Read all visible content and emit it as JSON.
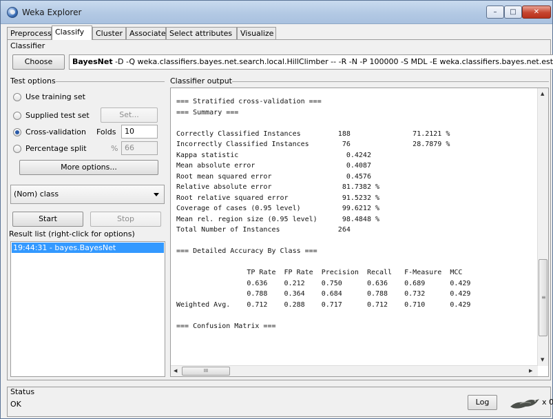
{
  "window": {
    "title": "Weka Explorer",
    "controls": {
      "minimize": "–",
      "maximize": "□",
      "close": "✕"
    }
  },
  "tabs": [
    "Preprocess",
    "Classify",
    "Cluster",
    "Associate",
    "Select attributes",
    "Visualize"
  ],
  "active_tab": "Classify",
  "classifier": {
    "group_title": "Classifier",
    "choose_label": "Choose",
    "name": "BayesNet",
    "options": " -D -Q weka.classifiers.bayes.net.search.local.HillClimber -- -R -N -P 100000 -S MDL -E weka.classifiers.bayes.net.estimate.SimpleEs"
  },
  "test_options": {
    "title": "Test options",
    "use_training": "Use training set",
    "supplied": "Supplied test set",
    "set_button": "Set...",
    "cross_validation": "Cross-validation",
    "folds_label": "Folds",
    "folds_value": "10",
    "percentage_split": "Percentage split",
    "percent_label": "%",
    "percent_value": "66",
    "more_options": "More options...",
    "selected": "Cross-validation"
  },
  "class_selector": {
    "value": "(Nom) class"
  },
  "run": {
    "start": "Start",
    "stop": "Stop"
  },
  "result_list": {
    "title": "Result list (right-click for options)",
    "items": [
      "19:44:31 - bayes.BayesNet"
    ]
  },
  "output": {
    "title": "Classifier output",
    "text": "=== Stratified cross-validation ===\n=== Summary ===\n\nCorrectly Classified Instances         188               71.2121 %\nIncorrectly Classified Instances        76               28.7879 %\nKappa statistic                          0.4242\nMean absolute error                      0.4087\nRoot mean squared error                  0.4576\nRelative absolute error                 81.7382 %\nRoot relative squared error             91.5232 %\nCoverage of cases (0.95 level)          99.6212 %\nMean rel. region size (0.95 level)      98.4848 %\nTotal Number of Instances              264\n\n=== Detailed Accuracy By Class ===\n\n                 TP Rate  FP Rate  Precision  Recall   F-Measure  MCC\n                 0.636    0.212    0.750      0.636    0.689      0.429\n                 0.788    0.364    0.684      0.788    0.732      0.429\nWeighted Avg.    0.712    0.288    0.717      0.712    0.710      0.429\n\n=== Confusion Matrix ===",
    "scroll_thumb_label": "III"
  },
  "status": {
    "title": "Status",
    "text": "OK",
    "log_label": "Log",
    "count": "x 0",
    "icon": "weka-bird-icon"
  }
}
